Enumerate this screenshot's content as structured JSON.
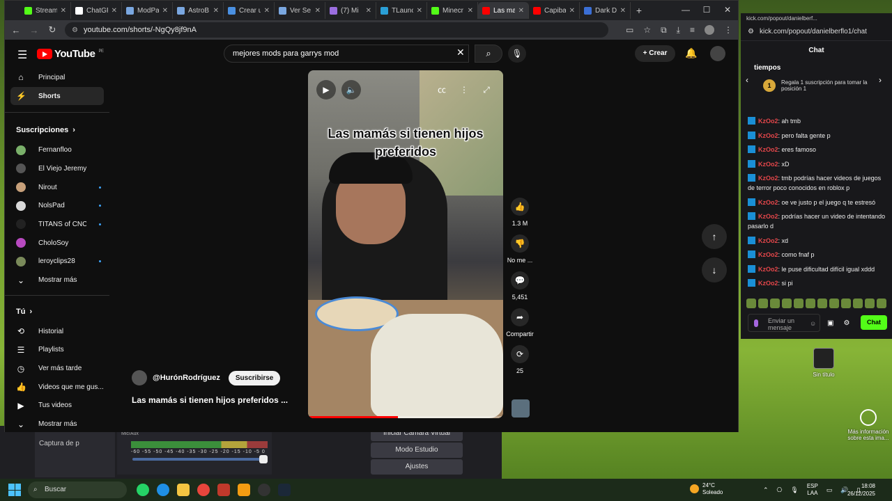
{
  "browser": {
    "tabs": [
      {
        "label": "Stream",
        "color": "#53fc18"
      },
      {
        "label": "ChatGP",
        "color": "#ffffff"
      },
      {
        "label": "ModPa",
        "color": "#7aa7e0"
      },
      {
        "label": "AstroB",
        "color": "#7aa7e0"
      },
      {
        "label": "Crear u",
        "color": "#4a90e2"
      },
      {
        "label": "Ver Se",
        "color": "#7aa7e0"
      },
      {
        "label": "(7) Mi",
        "color": "#9b6ee0"
      },
      {
        "label": "TLaunc",
        "color": "#2a9fd6"
      },
      {
        "label": "Minecr",
        "color": "#53fc18"
      },
      {
        "label": "Las ma",
        "color": "#ff0000",
        "active": true
      },
      {
        "label": "Capiba",
        "color": "#ff0000"
      },
      {
        "label": "Dark D",
        "color": "#3b6fd6"
      }
    ],
    "url": "youtube.com/shorts/-NgQy8jf9nA"
  },
  "youtube": {
    "logo_text": "YouTube",
    "region": "PE",
    "search_query": "mejores mods para garrys mod",
    "create_label": "Crear",
    "nav": [
      {
        "label": "Principal",
        "icon": "home-icon"
      },
      {
        "label": "Shorts",
        "icon": "shorts-icon"
      }
    ],
    "subscriptions_heading": "Suscripciones",
    "subscriptions": [
      {
        "name": "Fernanfloo",
        "color": "#7ab06a",
        "live": false
      },
      {
        "name": "El Viejo Jeremy",
        "color": "#555555",
        "live": false
      },
      {
        "name": "Nirout",
        "color": "#c7a07a",
        "live": true
      },
      {
        "name": "NolsPad",
        "color": "#d9d9d9",
        "live": true
      },
      {
        "name": "TITANS of CNC ...",
        "color": "#222222",
        "live": true
      },
      {
        "name": "CholoSoy",
        "color": "#b84ac0",
        "live": false
      },
      {
        "name": "leroyclips28",
        "color": "#7a8a5a",
        "live": true
      }
    ],
    "show_more_1": "Mostrar más",
    "you_heading": "Tú",
    "you_items": [
      {
        "label": "Historial",
        "icon": "history-icon"
      },
      {
        "label": "Playlists",
        "icon": "playlists-icon"
      },
      {
        "label": "Ver más tarde",
        "icon": "watch-later-icon"
      },
      {
        "label": "Videos que me gus...",
        "icon": "liked-videos-icon"
      },
      {
        "label": "Tus videos",
        "icon": "your-videos-icon"
      }
    ],
    "show_more_2": "Mostrar más",
    "short": {
      "caption": "Las mamás si tienen hijos preferidos",
      "channel": "@HurónRodríguez",
      "subscribe_label": "Suscribirse",
      "title": "Las mamás si tienen hijos preferidos ...",
      "progress": 0.46,
      "likes": "1.3 M",
      "dislike_label": "No me ...",
      "comments": "5,451",
      "share_label": "Compartir",
      "remix": "25"
    }
  },
  "kick": {
    "window_title": "kick.com/popout/danielberf...",
    "url": "kick.com/popout/danielberflo1/chat",
    "chat_heading": "Chat",
    "promo_title": "tiempos",
    "promo_rank": "1",
    "promo_text": "Regala 1 suscripción para tomar la posición 1",
    "messages": [
      {
        "user": "KzOo2",
        "text": "ah tmb"
      },
      {
        "user": "KzOo2",
        "text": "pero falta gente p"
      },
      {
        "user": "KzOo2",
        "text": "eres famoso"
      },
      {
        "user": "KzOo2",
        "text": "xD"
      },
      {
        "user": "KzOo2",
        "text": "tmb podrías hacer videos de juegos de terror poco conocidos en roblox p"
      },
      {
        "user": "KzOo2",
        "text": "oe ve justo p el juego q te estresó"
      },
      {
        "user": "KzOo2",
        "text": "podrías hacer un video de intentando pasarlo d"
      },
      {
        "user": "KzOo2",
        "text": "xd"
      },
      {
        "user": "KzOo2",
        "text": "como fnaf p"
      },
      {
        "user": "KzOo2",
        "text": "le puse dificultad difícil igual xddd"
      },
      {
        "user": "KzOo2",
        "text": "si pi"
      }
    ],
    "input_placeholder": "Enviar un mensaje",
    "send_label": "Chat"
  },
  "obs": {
    "scene_item": "Captura de p",
    "mixer_label": "Mic/Aux",
    "meter_scale": "-60 -55 -50 -45 -40 -35 -30 -25 -20 -15 -10 -5 0",
    "virtual_cam": "Iniciar Cámara Virtual",
    "studio_mode": "Modo Estudio",
    "settings": "Ajustes"
  },
  "desktop": {
    "icon1": "Sin título",
    "icon2": "Más información sobre esta ima..."
  },
  "taskbar": {
    "search_label": "Buscar",
    "temp": "24°C",
    "weather": "Soleado",
    "lang1": "ESP",
    "lang2": "LAA",
    "time": "18:08",
    "date": "26/12/2025"
  }
}
